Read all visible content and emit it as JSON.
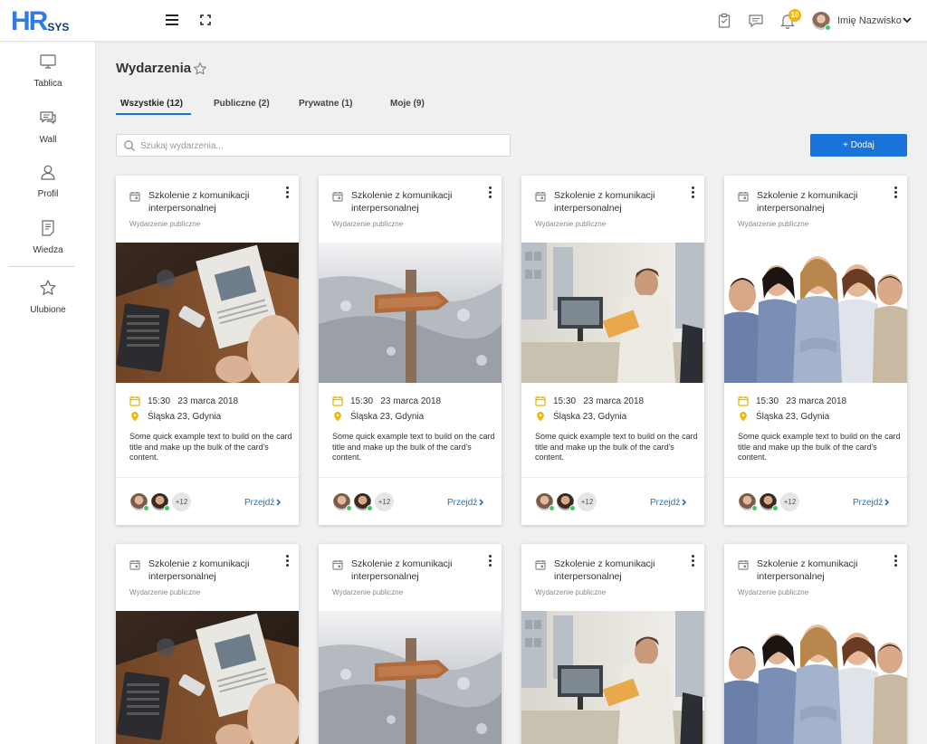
{
  "brand": {
    "logo_text": "HR",
    "logo_sub": "SYS"
  },
  "header": {
    "notifications_count": "10",
    "user_name": "Imię Nazwisko"
  },
  "sidebar": {
    "items": [
      {
        "label": "Tablica",
        "icon": "monitor-icon"
      },
      {
        "label": "Wall",
        "icon": "chat-icon"
      },
      {
        "label": "Profil",
        "icon": "user-icon"
      },
      {
        "label": "Wiedza",
        "icon": "document-icon"
      },
      {
        "label": "Ulubione",
        "icon": "star-icon"
      }
    ]
  },
  "page": {
    "title": "Wydarzenia"
  },
  "tabs": [
    {
      "label": "Wszystkie (12)",
      "active": true
    },
    {
      "label": "Publiczne (2)",
      "active": false
    },
    {
      "label": "Prywatne (1)",
      "active": false
    },
    {
      "label": "Moje (9)",
      "active": false
    }
  ],
  "search": {
    "placeholder": "Szukaj wydarzenia..."
  },
  "add_button": {
    "label": "+ Dodaj"
  },
  "cards": [
    {
      "title": "Szkolenie z komunikacji interpersonalnej",
      "type": "Wydarzenie publiczne",
      "time": "15:30",
      "date": "23 marca 2018",
      "location": "Śląska 23, Gdynia",
      "description": "Some quick example text to build on the card title and make up the bulk of the card's content.",
      "more_participants": "+12",
      "link": "Przejdź",
      "image": "newspaper"
    },
    {
      "title": "Szkolenie z komunikacji interpersonalnej",
      "type": "Wydarzenie publiczne",
      "time": "15:30",
      "date": "23 marca 2018",
      "location": "Śląska 23, Gdynia",
      "description": "Some quick example text to build on the card title and make up the bulk of the card's content.",
      "more_participants": "+12",
      "link": "Przejdź",
      "image": "signpost"
    },
    {
      "title": "Szkolenie z komunikacji interpersonalnej",
      "type": "Wydarzenie publiczne",
      "time": "15:30",
      "date": "23 marca 2018",
      "location": "Śląska 23, Gdynia",
      "description": "Some quick example text to build on the card title and make up the bulk of the card's content.",
      "more_participants": "+12",
      "link": "Przejdź",
      "image": "office"
    },
    {
      "title": "Szkolenie z komunikacji interpersonalnej",
      "type": "Wydarzenie publiczne",
      "time": "15:30",
      "date": "23 marca 2018",
      "location": "Śląska 23, Gdynia",
      "description": "Some quick example text to build on the card title and make up the bulk of the card's content.",
      "more_participants": "+12",
      "link": "Przejdź",
      "image": "people"
    },
    {
      "title": "Szkolenie z komunikacji interpersonalnej",
      "type": "Wydarzenie publiczne",
      "image": "newspaper"
    },
    {
      "title": "Szkolenie z komunikacji interpersonalnej",
      "type": "Wydarzenie publiczne",
      "image": "signpost"
    },
    {
      "title": "Szkolenie z komunikacji interpersonalnej",
      "type": "Wydarzenie publiczne",
      "image": "office"
    },
    {
      "title": "Szkolenie z komunikacji interpersonalnej",
      "type": "Wydarzenie publiczne",
      "image": "people"
    }
  ],
  "colors": {
    "accent": "#1a73d9",
    "badge": "#f5b400",
    "meta_icon": "#f0b400",
    "online": "#3cc46c"
  }
}
